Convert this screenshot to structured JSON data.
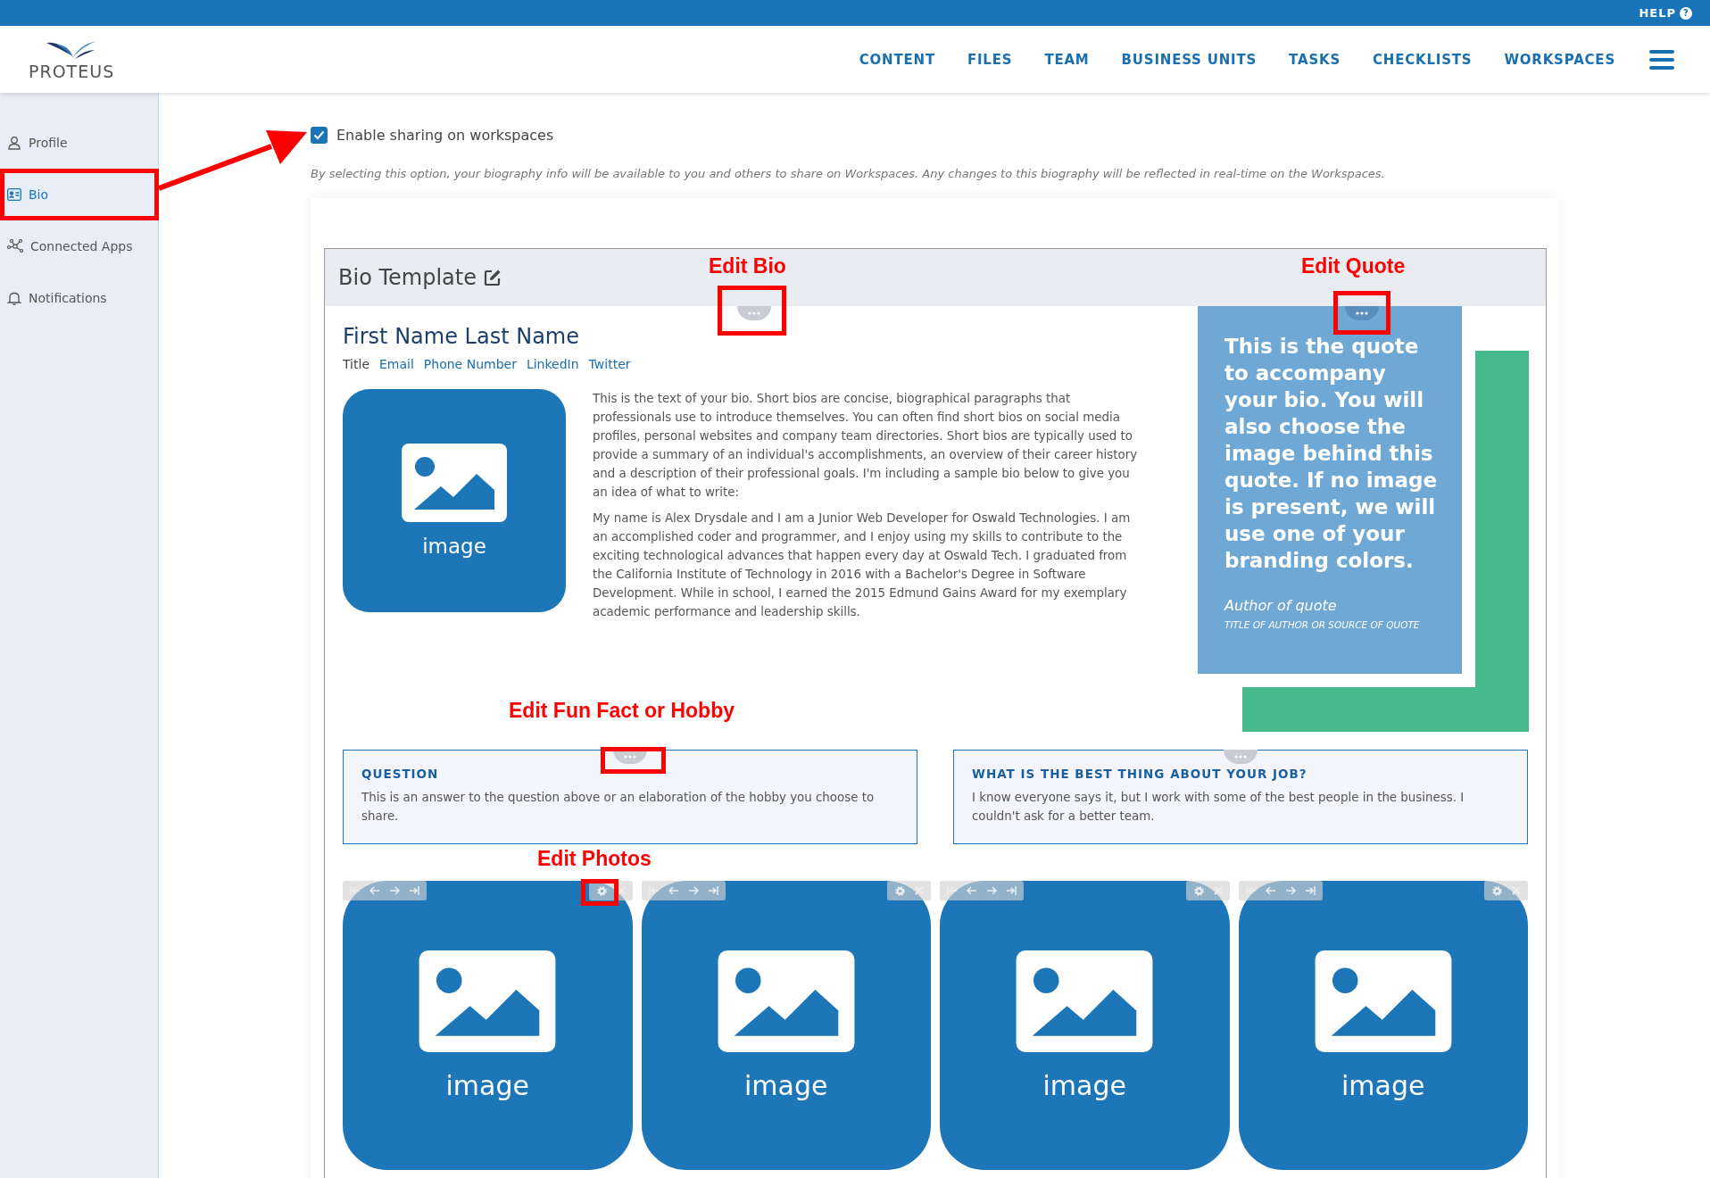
{
  "top_bar": {
    "help_label": "HELP",
    "help_icon": "?"
  },
  "header": {
    "logo_text": "PROTEUS",
    "nav": [
      "CONTENT",
      "FILES",
      "TEAM",
      "BUSINESS UNITS",
      "TASKS",
      "CHECKLISTS",
      "WORKSPACES"
    ]
  },
  "sidebar": {
    "items": [
      {
        "label": "Profile",
        "kind": "person",
        "selected": false,
        "highlighted": false
      },
      {
        "label": "Bio",
        "kind": "card",
        "selected": true,
        "highlighted": true
      },
      {
        "label": "Connected Apps",
        "kind": "network",
        "selected": false,
        "highlighted": false
      },
      {
        "label": "Notifications",
        "kind": "bell",
        "selected": false,
        "highlighted": false
      }
    ]
  },
  "sharing": {
    "label": "Enable sharing on workspaces",
    "checked": true,
    "note": "By selecting this option, your biography info will be available to you and others to share on Workspaces. Any changes to this biography will be reflected in real-time on the Workspaces."
  },
  "bio_template": {
    "title": "Bio Template",
    "note": "Edit Bio",
    "name": "First Name Last Name",
    "contact": [
      {
        "label": "Title",
        "kind": "text"
      },
      {
        "label": "Email",
        "kind": "link"
      },
      {
        "label": "Phone Number",
        "kind": "link"
      },
      {
        "label": "LinkedIn",
        "kind": "link"
      },
      {
        "label": "Twitter",
        "kind": "link"
      }
    ],
    "portrait_label": "image",
    "paragraphs": [
      "This is the text of your bio. Short bios are concise, biographical paragraphs that professionals use to introduce themselves. You can often find short bios on social media profiles, personal websites and company team directories. Short bios are typically used to provide a summary of an individual's accomplishments, an overview of their career history and a description of their professional goals. I'm including a sample bio below to give you an idea of what to write:",
      "My name is Alex Drysdale and I am a Junior Web Developer for Oswald Technologies. I am an accomplished coder and programmer, and I enjoy using my skills to contribute to the exciting technological advances that happen every day at Oswald Tech. I graduated from the California Institute of Technology in 2016 with a Bachelor's Degree in Software Development. While in school, I earned the 2015 Edmund Gains Award for my exemplary academic performance and leadership skills."
    ],
    "quote": {
      "note": "Edit Quote",
      "text": "This is the quote to accompany your bio. You will also choose the image behind this quote. If no image is present, we will use one of your branding colors.",
      "author": "Author of quote",
      "source": "TITLE OF AUTHOR OR SOURCE OF QUOTE"
    },
    "facts": [
      {
        "note": "Edit Fun Fact or Hobby",
        "question": "QUESTION",
        "answer": "This is an answer to the question above or an elaboration of the hobby you choose to share."
      },
      {
        "question": "WHAT IS THE BEST THING ABOUT YOUR JOB?",
        "answer": "I know everyone says it, but I work with some of the best people in the business. I couldn't ask for a better team."
      }
    ],
    "photos": [
      {
        "label": "image",
        "note": "Edit Photos"
      },
      {
        "label": "image"
      },
      {
        "label": "image"
      },
      {
        "label": "image"
      }
    ]
  }
}
